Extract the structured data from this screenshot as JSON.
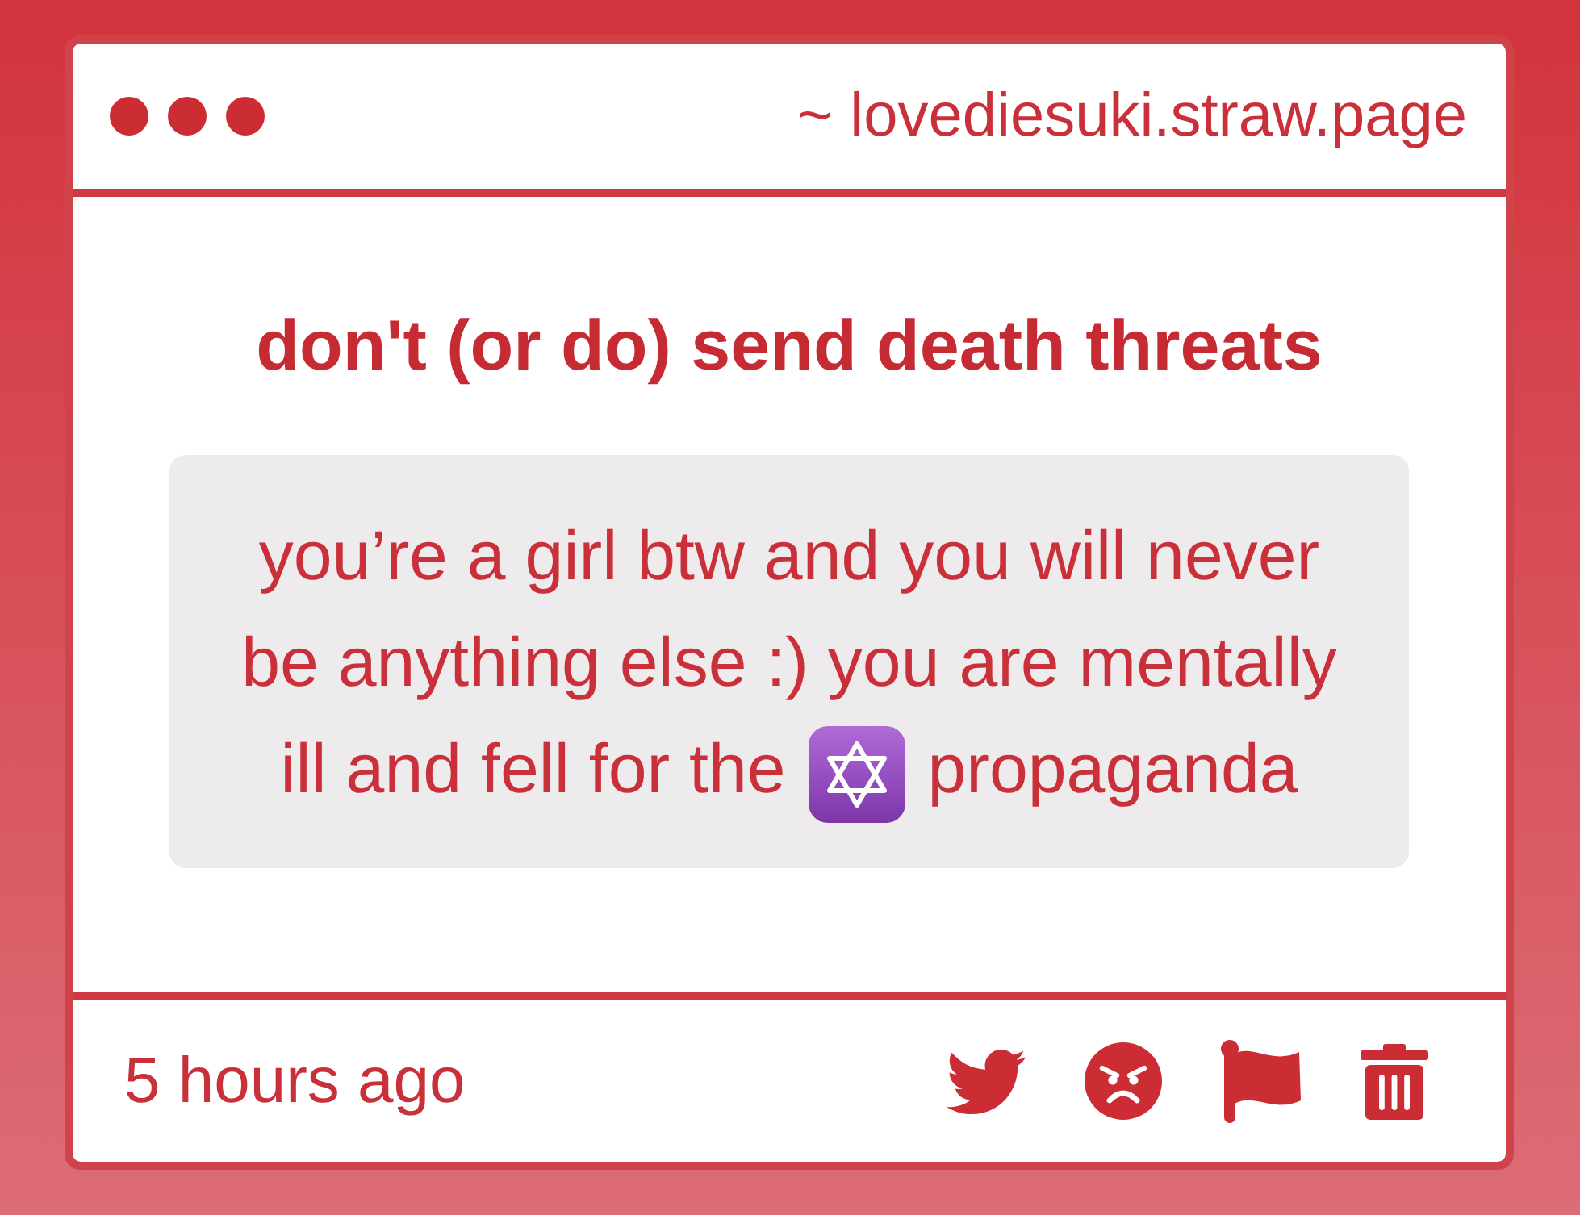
{
  "header": {
    "address": "~ lovediesuki.straw.page"
  },
  "post": {
    "title": "don't (or do) send death threats",
    "message": [
      {
        "kind": "text",
        "text": "you’re a girl btw and you will never be anything else :) you are mentally ill and fell for the"
      },
      {
        "kind": "emoji"
      },
      {
        "kind": "text",
        "text": "propaganda"
      }
    ]
  },
  "footer": {
    "time": "5 hours ago",
    "actions": [
      {
        "kind": "bird"
      },
      {
        "kind": "angry"
      },
      {
        "kind": "flag"
      },
      {
        "kind": "trash"
      }
    ]
  }
}
